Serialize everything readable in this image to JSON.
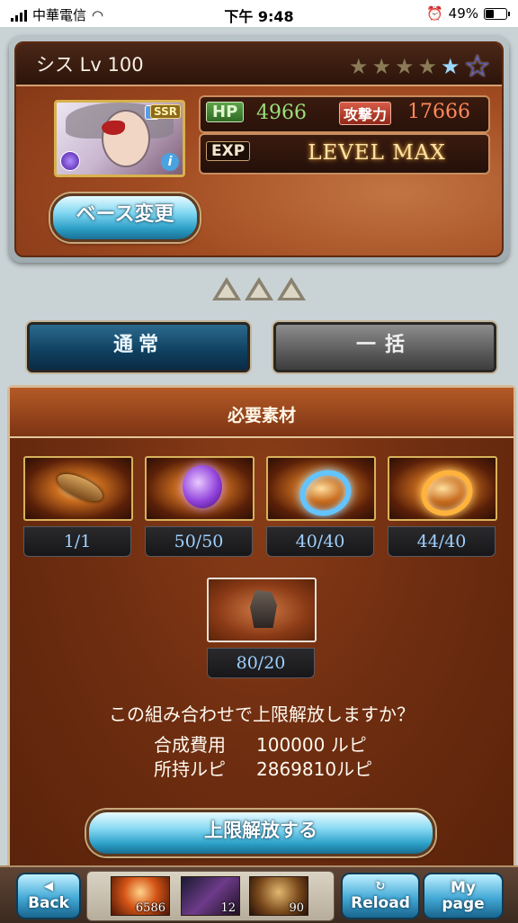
{
  "status_bar": {
    "carrier": "中華電信",
    "time": "下午 9:48",
    "battery": "49%"
  },
  "character": {
    "name_level": "シス Lv 100",
    "rarity": "SSR",
    "stars_total": 5,
    "stars_lit": 5,
    "hp_label": "HP",
    "hp": "4966",
    "atk_label": "攻撃力",
    "atk": "17666",
    "exp_label": "EXP",
    "exp_status": "LEVEL MAX",
    "base_change_label": "ベース変更"
  },
  "tabs": {
    "normal": "通常",
    "bulk": "一括"
  },
  "materials": {
    "title": "必要素材",
    "items": [
      {
        "icon": "gauntlet-icon",
        "count": "1/1"
      },
      {
        "icon": "purple-orb-icon",
        "count": "50/50"
      },
      {
        "icon": "blue-ring-icon",
        "count": "40/40"
      },
      {
        "icon": "gold-ring-icon",
        "count": "44/40"
      },
      {
        "icon": "rubble-icon",
        "count": "80/20"
      }
    ],
    "confirm_question": "この組み合わせで上限解放しますか？",
    "cost_label": "合成費用",
    "cost_value": "100000 ルピ",
    "owned_label": "所持ルピ",
    "owned_value": "2869810ルピ",
    "uncap_button": "上限解放する"
  },
  "bottom_nav": {
    "back": "Back",
    "reload": "Reload",
    "my": "My",
    "page": "page",
    "tray": [
      "6586",
      "12",
      "90"
    ]
  }
}
